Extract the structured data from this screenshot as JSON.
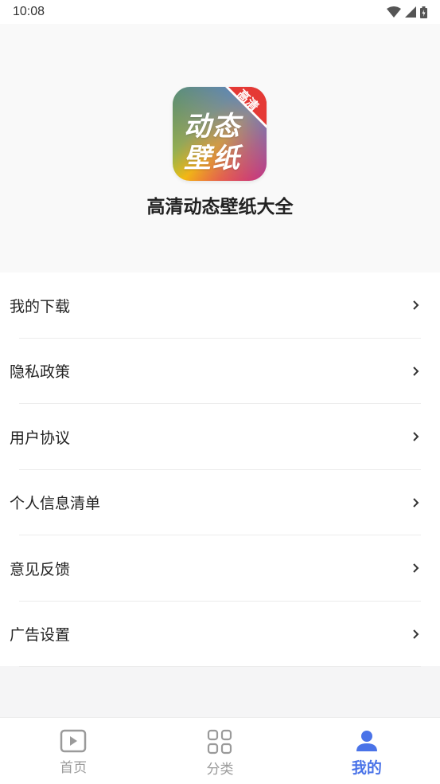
{
  "status_bar": {
    "time": "10:08"
  },
  "header": {
    "app_name": "高清动态壁纸大全",
    "logo": {
      "line1": "动态",
      "line2": "壁纸",
      "badge": "高清"
    }
  },
  "menu": {
    "items": [
      {
        "label": "我的下载"
      },
      {
        "label": "隐私政策"
      },
      {
        "label": "用户协议"
      },
      {
        "label": "个人信息清单"
      },
      {
        "label": "意见反馈"
      },
      {
        "label": "广告设置"
      }
    ]
  },
  "bottom_nav": {
    "tabs": [
      {
        "label": "首页",
        "icon": "play-icon"
      },
      {
        "label": "分类",
        "icon": "grid-icon"
      },
      {
        "label": "我的",
        "icon": "user-icon",
        "active": true
      }
    ]
  },
  "colors": {
    "accent": "#4a73e8",
    "inactive": "#9a9a9a"
  }
}
